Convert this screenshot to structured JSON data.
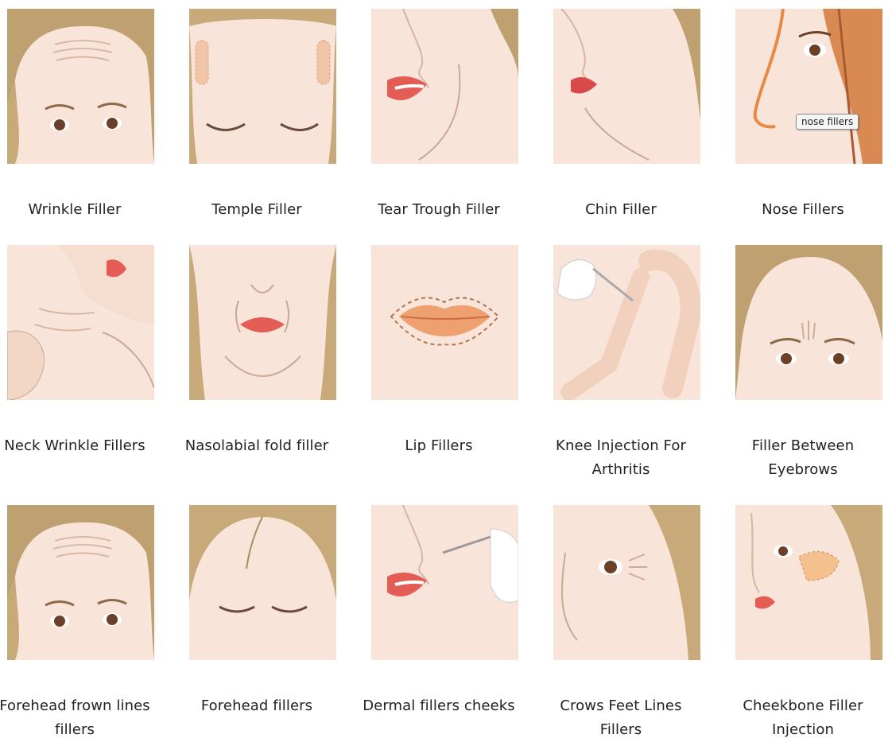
{
  "items": [
    {
      "label": "Wrinkle Filler",
      "icon": "forehead-wrinkle-face"
    },
    {
      "label": "Temple Filler",
      "icon": "temple-face"
    },
    {
      "label": "Tear Trough Filler",
      "icon": "lips-profile"
    },
    {
      "label": "Chin Filler",
      "icon": "chin-profile"
    },
    {
      "label": "Nose Fillers",
      "icon": "nose-profile"
    },
    {
      "label": "Neck Wrinkle Fillers",
      "icon": "neck"
    },
    {
      "label": "Nasolabial fold filler",
      "icon": "lower-face"
    },
    {
      "label": "Lip Fillers",
      "icon": "lips-outline"
    },
    {
      "label": "Knee Injection For Arthritis",
      "icon": "legs-injection"
    },
    {
      "label": "Filler Between Eyebrows",
      "icon": "glabella-face"
    },
    {
      "label": "Forehead frown lines fillers",
      "icon": "forehead-wrinkle-face"
    },
    {
      "label": "Forehead fillers",
      "icon": "closed-eyes-face"
    },
    {
      "label": "Dermal fillers cheeks",
      "icon": "cheek-injection-profile"
    },
    {
      "label": "Crows Feet Lines Fillers",
      "icon": "crows-feet-eye"
    },
    {
      "label": "Cheekbone Filler Injection",
      "icon": "cheekbone-profile"
    }
  ],
  "tooltip": "nose fillers",
  "colors": {
    "skin": "#f7e3d8",
    "hair": "#b89a6c",
    "lip": "#e0625a",
    "text": "#222222"
  }
}
